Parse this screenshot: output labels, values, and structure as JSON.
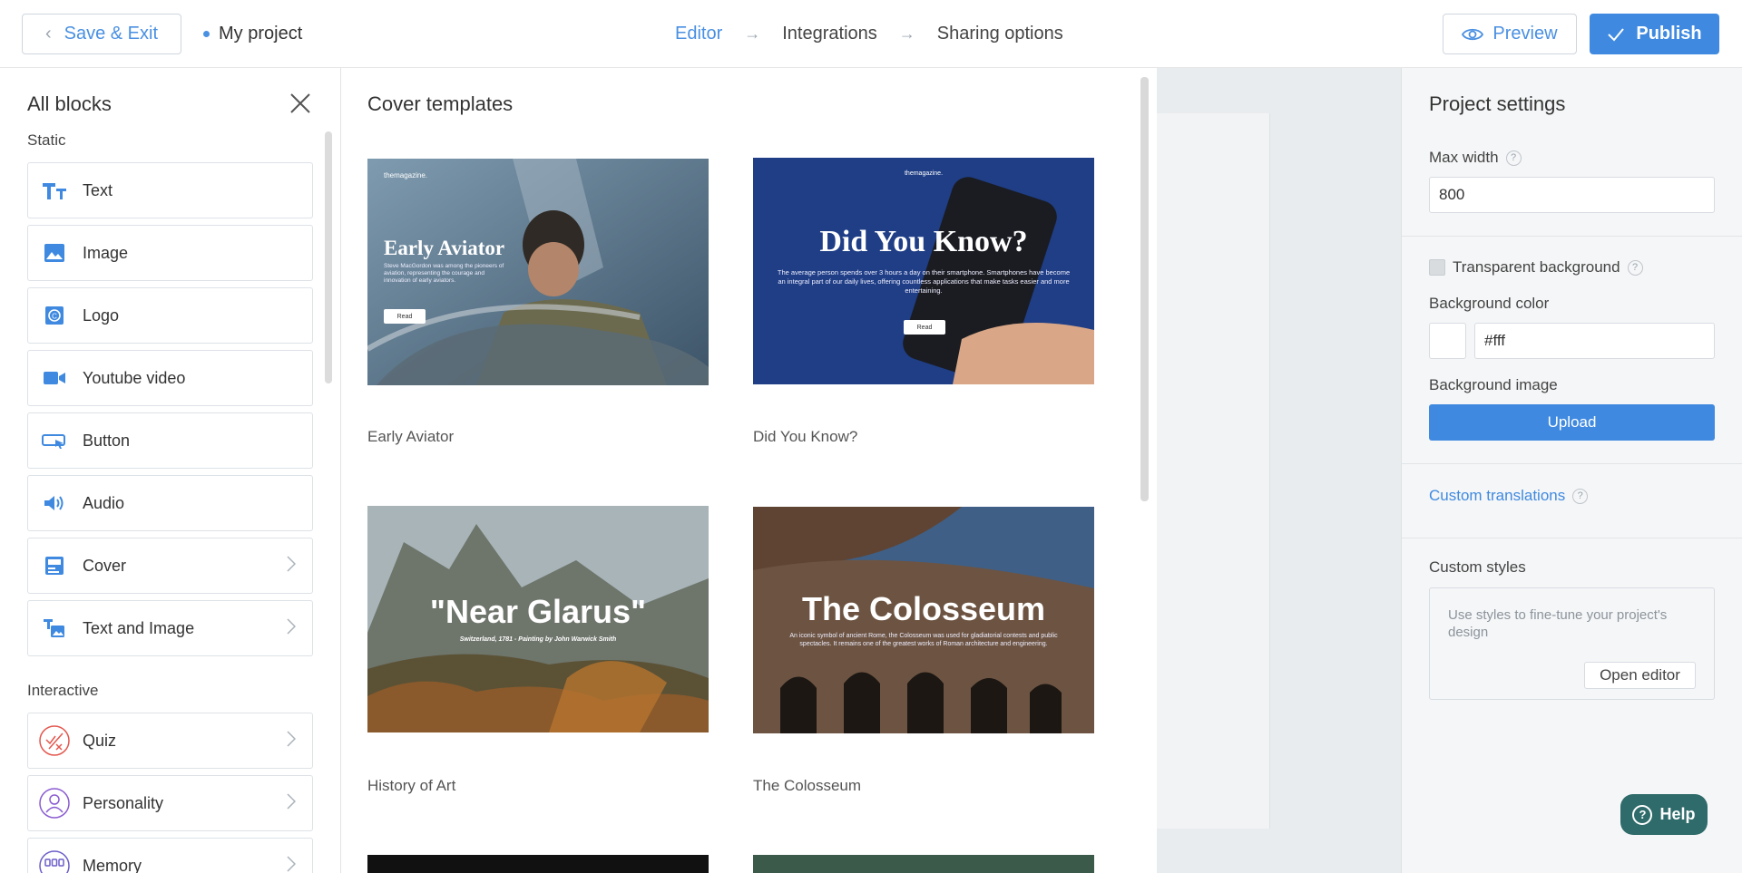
{
  "topbar": {
    "save_exit": "Save & Exit",
    "project_name": "My project",
    "steps": [
      "Editor",
      "Integrations",
      "Sharing options"
    ],
    "preview": "Preview",
    "publish": "Publish"
  },
  "blocks_panel": {
    "title": "All blocks",
    "static_label": "Static",
    "static_items": [
      {
        "label": "Text",
        "icon": "text-icon"
      },
      {
        "label": "Image",
        "icon": "image-icon"
      },
      {
        "label": "Logo",
        "icon": "logo-icon"
      },
      {
        "label": "Youtube video",
        "icon": "video-icon"
      },
      {
        "label": "Button",
        "icon": "button-icon"
      },
      {
        "label": "Audio",
        "icon": "audio-icon"
      },
      {
        "label": "Cover",
        "icon": "cover-icon"
      },
      {
        "label": "Text and Image",
        "icon": "text-image-icon"
      }
    ],
    "interactive_label": "Interactive",
    "interactive_items": [
      {
        "label": "Quiz",
        "icon": "quiz-icon"
      },
      {
        "label": "Personality",
        "icon": "personality-icon"
      },
      {
        "label": "Memory",
        "icon": "memory-icon"
      }
    ]
  },
  "templates_panel": {
    "title": "Cover templates",
    "templates": [
      {
        "caption": "Early Aviator",
        "brand": "themagazine.",
        "heading": "Early Aviator",
        "body": "Steve MacGordon was among the pioneers of aviation, representing the courage and innovation of early aviators.",
        "button": "Read"
      },
      {
        "caption": "Did You Know?",
        "brand": "themagazine.",
        "heading": "Did You Know?",
        "body": "The average person spends over 3 hours a day on their smartphone. Smartphones have become an integral part of our daily lives, offering countless applications that make tasks easier and more entertaining.",
        "button": "Read"
      },
      {
        "caption": "History of Art",
        "heading": "\"Near Glarus\"",
        "body": "Switzerland, 1781 - Painting by John Warwick Smith"
      },
      {
        "caption": "The Colosseum",
        "heading": "The Colosseum",
        "body": "An iconic symbol of ancient Rome, the Colosseum was used for gladiatorial contests and public spectacles. It remains one of the greatest works of Roman architecture and engineering."
      }
    ]
  },
  "settings": {
    "title": "Project settings",
    "max_width_label": "Max width",
    "max_width_value": "800",
    "transparent_label": "Transparent background",
    "bg_color_label": "Background color",
    "bg_color_value": "#fff",
    "bg_image_label": "Background image",
    "upload": "Upload",
    "custom_translations": "Custom translations",
    "custom_styles_label": "Custom styles",
    "custom_styles_hint": "Use styles to fine-tune your project's design",
    "open_editor": "Open editor"
  },
  "help": {
    "label": "Help"
  },
  "colors": {
    "accent": "#3f8ae0",
    "help_bg": "#2e6b6a"
  }
}
